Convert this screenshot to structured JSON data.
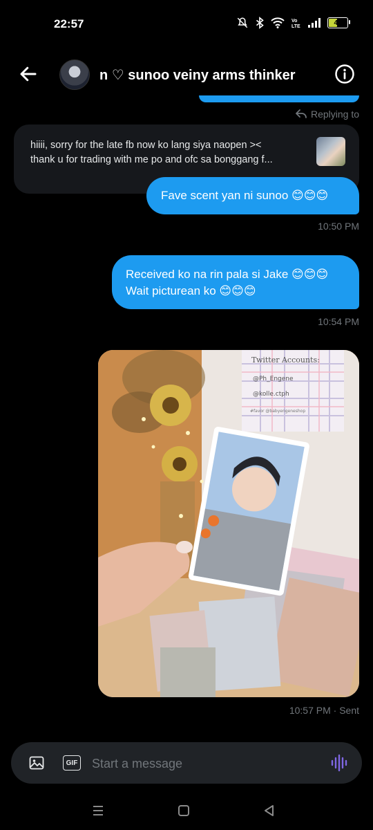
{
  "status_bar": {
    "time": "22:57",
    "battery": "44"
  },
  "header": {
    "title": "n ♡ sunoo veiny arms thinker"
  },
  "reply": {
    "label": "Replying to",
    "line1": "hiiii, sorry for the late fb now ko lang siya naopen ><",
    "line2": "thank u for trading with me po and ofc sa bonggang f..."
  },
  "messages": [
    {
      "text": "Fave scent yan ni sunoo 😊😊😊",
      "time": "10:50 PM"
    },
    {
      "line1": "Received ko na rin pala si Jake 😊😊😊",
      "line2": "Wait picturean ko 😊😊😊",
      "time": "10:54 PM"
    },
    {
      "type": "image",
      "time": "10:57 PM · Sent"
    }
  ],
  "photo_text": {
    "sign_title": "Twitter Accounts:",
    "sign_line1": "@Ph_Engene",
    "sign_line2": "@kolle.ctph",
    "sign_line3": "#favor @babyengeneshop"
  },
  "composer": {
    "placeholder": "Start a message",
    "gif_label": "GIF"
  },
  "colors": {
    "accent": "#1d9bf0",
    "background": "#000000",
    "muted": "#71767b"
  }
}
